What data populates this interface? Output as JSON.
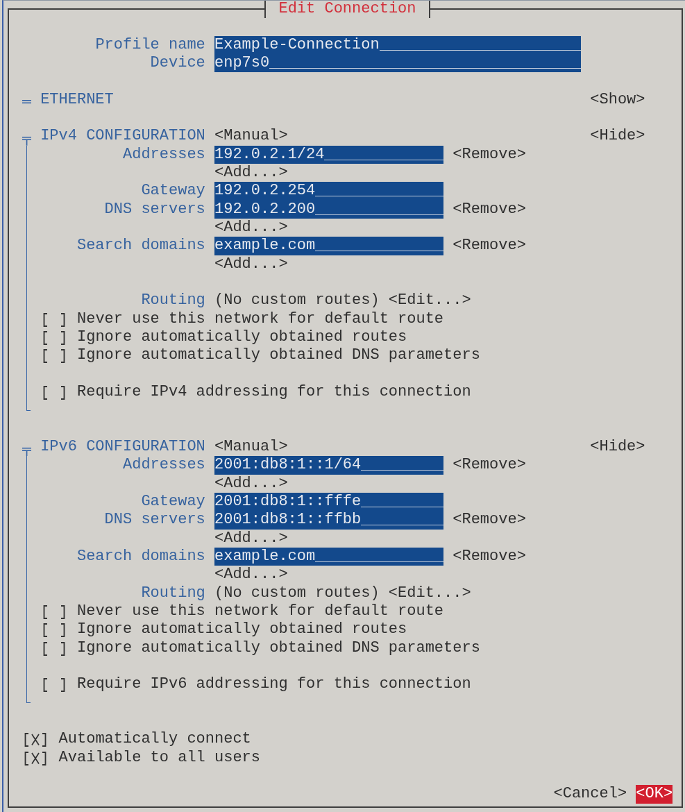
{
  "window": {
    "title": "Edit Connection"
  },
  "profile_fields": [
    {
      "label": "Profile name",
      "value": "Example-Connection"
    },
    {
      "label": "Device",
      "value": "enp7s0"
    }
  ],
  "sections": [
    {
      "title": "ETHERNET",
      "toggle": "<Show>",
      "expanded": false
    },
    {
      "title": "IPv4 CONFIGURATION",
      "method": "<Manual>",
      "toggle": "<Hide>",
      "expanded": true,
      "groups": [
        {
          "rows": [
            {
              "kind": "field",
              "label": "Addresses",
              "value": "192.0.2.1/24",
              "action": "<Remove>"
            },
            {
              "kind": "add",
              "button": "<Add...>"
            },
            {
              "kind": "field",
              "label": "Gateway",
              "value": "192.0.2.254"
            },
            {
              "kind": "field",
              "label": "DNS servers",
              "value": "192.0.2.200",
              "action": "<Remove>"
            },
            {
              "kind": "add",
              "button": "<Add...>"
            },
            {
              "kind": "field",
              "label": "Search domains",
              "value": "example.com",
              "action": "<Remove>"
            },
            {
              "kind": "add",
              "button": "<Add...>"
            }
          ]
        },
        {
          "rows": [
            {
              "kind": "routing",
              "label": "Routing",
              "value": "(No custom routes)",
              "button": "<Edit...>"
            },
            {
              "kind": "checkbox",
              "label": "Never use this network for default route",
              "checked": false
            },
            {
              "kind": "checkbox",
              "label": "Ignore automatically obtained routes",
              "checked": false
            },
            {
              "kind": "checkbox",
              "label": "Ignore automatically obtained DNS parameters",
              "checked": false
            }
          ]
        },
        {
          "rows": [
            {
              "kind": "checkbox",
              "label": "Require IPv4 addressing for this connection",
              "checked": false
            }
          ]
        }
      ]
    },
    {
      "title": "IPv6 CONFIGURATION",
      "method": "<Manual>",
      "toggle": "<Hide>",
      "expanded": true,
      "groups": [
        {
          "rows": [
            {
              "kind": "field",
              "label": "Addresses",
              "value": "2001:db8:1::1/64",
              "action": "<Remove>"
            },
            {
              "kind": "add",
              "button": "<Add...>"
            },
            {
              "kind": "field",
              "label": "Gateway",
              "value": "2001:db8:1::fffe"
            },
            {
              "kind": "field",
              "label": "DNS servers",
              "value": "2001:db8:1::ffbb",
              "action": "<Remove>"
            },
            {
              "kind": "add",
              "button": "<Add...>"
            },
            {
              "kind": "field",
              "label": "Search domains",
              "value": "example.com",
              "action": "<Remove>"
            },
            {
              "kind": "add",
              "button": "<Add...>"
            },
            {
              "kind": "routing",
              "label": "Routing",
              "value": "(No custom routes)",
              "button": "<Edit...>"
            },
            {
              "kind": "checkbox",
              "label": "Never use this network for default route",
              "checked": false
            },
            {
              "kind": "checkbox",
              "label": "Ignore automatically obtained routes",
              "checked": false
            },
            {
              "kind": "checkbox",
              "label": "Ignore automatically obtained DNS parameters",
              "checked": false
            }
          ]
        },
        {
          "rows": [
            {
              "kind": "checkbox",
              "label": "Require IPv6 addressing for this connection",
              "checked": false
            }
          ]
        }
      ]
    }
  ],
  "options": [
    {
      "label": "Automatically connect",
      "checked": true
    },
    {
      "label": "Available to all users",
      "checked": true
    }
  ],
  "buttons": [
    {
      "label": "<Cancel>",
      "focused": false
    },
    {
      "label": "<OK>",
      "focused": true
    }
  ]
}
